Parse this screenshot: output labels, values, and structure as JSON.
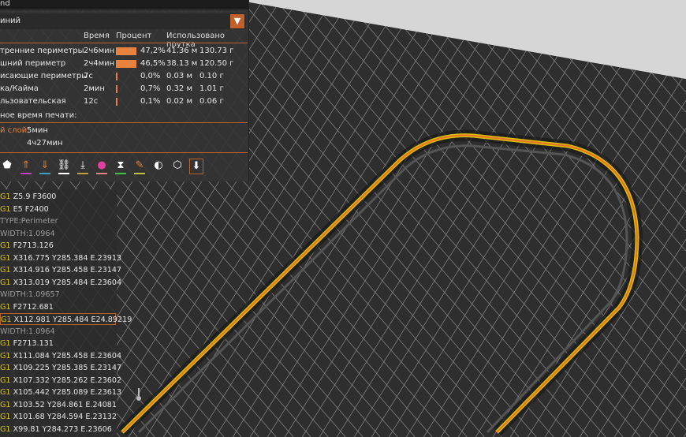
{
  "legend": {
    "title": "nd",
    "view_type": "иний",
    "headers": {
      "time": "Время",
      "percent": "Процент",
      "used": "Использовано прутка"
    },
    "rows": [
      {
        "name": "тренние периметры",
        "time": "2ч6мин",
        "percent_text": "47,2%",
        "percent": 47.2,
        "length": "41.36 м",
        "weight": "130.73 г"
      },
      {
        "name": "шний периметр",
        "time": "2ч4мин",
        "percent_text": "46,5%",
        "percent": 46.5,
        "length": "38.13 м",
        "weight": "120.50 г"
      },
      {
        "name": "исающие периметры",
        "time": "7с",
        "percent_text": "0,0%",
        "percent": 0.0,
        "length": "0.03 м",
        "weight": "0.10 г"
      },
      {
        "name": "ка/Кайма",
        "time": "2мин",
        "percent_text": "0,7%",
        "percent": 0.7,
        "length": "0.32 м",
        "weight": "1.01 г"
      },
      {
        "name": "льзовательская",
        "time": "12с",
        "percent_text": "0,1%",
        "percent": 0.1,
        "length": "0.02 м",
        "weight": "0.06 г"
      }
    ],
    "est_label": "ное время печати:",
    "first_layer_label": "й слой:",
    "first_layer_value": "5мин",
    "total_value": "4ч27мин",
    "accent": "#e8833f"
  },
  "toolbar_icons": [
    {
      "name": "shells-icon",
      "glyph": "⬟",
      "color": "#ffffff",
      "ul": ""
    },
    {
      "name": "travel-up-icon",
      "glyph": "⇑",
      "color": "#e8833f",
      "ul": "#c040c0"
    },
    {
      "name": "travel-down-icon",
      "glyph": "⇓",
      "color": "#e8833f",
      "ul": "#40a0c0"
    },
    {
      "name": "wipe-icon",
      "glyph": "⛓",
      "color": "#ffffff",
      "ul": "#ffffff"
    },
    {
      "name": "retract-icon",
      "glyph": "⤓",
      "color": "#ffffff",
      "ul": "#c0a040"
    },
    {
      "name": "color-change-icon",
      "glyph": "●",
      "color": "#e040a0",
      "ul": "#e08080"
    },
    {
      "name": "pause-icon",
      "glyph": "⧗",
      "color": "#ffffff",
      "ul": "#40c040"
    },
    {
      "name": "custom-gcode-icon",
      "glyph": "✎",
      "color": "#e8833f",
      "ul": "#c0c040"
    },
    {
      "name": "center-of-gravity-icon",
      "glyph": "◐",
      "color": "#ffffff",
      "ul": ""
    },
    {
      "name": "wireframe-cube-icon",
      "glyph": "⬡",
      "color": "#ffffff",
      "ul": ""
    },
    {
      "name": "tool-marker-icon",
      "glyph": "⬇",
      "color": "#ffffff",
      "ul": ""
    }
  ],
  "gcode": [
    {
      "cmd": "G1",
      "args": " Z5.9 F3600"
    },
    {
      "cmd": "G1",
      "args": " E5 F2400"
    },
    {
      "cmd": "",
      "args": "TYPE:Perimeter",
      "comment": true
    },
    {
      "cmd": "",
      "args": "WIDTH:1.0964",
      "comment": true
    },
    {
      "cmd": "G1",
      "args": " F2713.126"
    },
    {
      "cmd": "G1",
      "args": " X316.775 Y285.384 E.23913"
    },
    {
      "cmd": "G1",
      "args": " X314.916 Y285.458 E.23147"
    },
    {
      "cmd": "G1",
      "args": " X313.019 Y285.484 E.23604"
    },
    {
      "cmd": "",
      "args": "WIDTH:1.09657",
      "comment": true
    },
    {
      "cmd": "G1",
      "args": " F2712.681"
    },
    {
      "cmd": "G1",
      "args": " X112.981 Y285.484 E24.89219",
      "selected": true
    },
    {
      "cmd": "",
      "args": "WIDTH:1.0964",
      "comment": true
    },
    {
      "cmd": "G1",
      "args": " F2713.131"
    },
    {
      "cmd": "G1",
      "args": " X111.084 Y285.458 E.23604"
    },
    {
      "cmd": "G1",
      "args": " X109.225 Y285.385 E.23147"
    },
    {
      "cmd": "G1",
      "args": " X107.332 Y285.262 E.23602"
    },
    {
      "cmd": "G1",
      "args": " X105.442 Y285.089 E.23613"
    },
    {
      "cmd": "G1",
      "args": " X103.52 Y284.861 E.24081"
    },
    {
      "cmd": "G1",
      "args": " X101.68 Y284.594 E.23132"
    },
    {
      "cmd": "G1",
      "args": " X99.81 Y284.273 E.23606"
    }
  ]
}
